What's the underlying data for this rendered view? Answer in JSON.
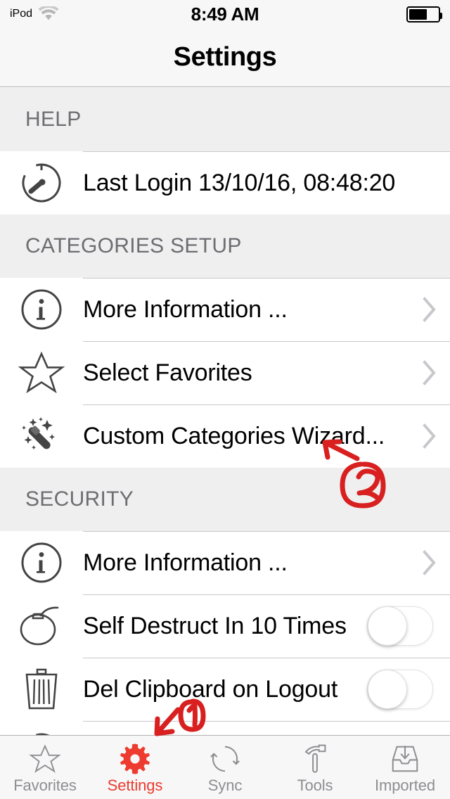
{
  "status_bar": {
    "carrier": "iPod",
    "wifi_icon": "wifi-icon",
    "time": "8:49 AM",
    "battery_icon": "battery-icon",
    "battery_level_percent": 57
  },
  "nav": {
    "title": "Settings"
  },
  "colors": {
    "accent": "#ee3b2f",
    "annotation": "#dd2222",
    "section_header_bg": "#efefef",
    "section_header_text": "#6d6d72",
    "row_bg": "#ffffff",
    "separator": "#c8c7cc",
    "chevron": "#c7c7cc",
    "icon": "#444444",
    "tab_inactive": "#8e8e93"
  },
  "sections": [
    {
      "header": "HELP",
      "rows": [
        {
          "label": "Last Login 13/10/16, 08:48:20",
          "icon": "stopwatch-icon",
          "accessory": "none",
          "name": "row-last-login"
        }
      ]
    },
    {
      "header": "CATEGORIES SETUP",
      "rows": [
        {
          "label": "More Information ...",
          "icon": "info-circle-icon",
          "accessory": "chevron",
          "name": "row-categories-more-information"
        },
        {
          "label": "Select Favorites",
          "icon": "star-outline-icon",
          "accessory": "chevron",
          "name": "row-select-favorites"
        },
        {
          "label": "Custom Categories Wizard...",
          "icon": "magic-wand-icon",
          "accessory": "chevron",
          "name": "row-custom-categories-wizard"
        }
      ]
    },
    {
      "header": "SECURITY",
      "rows": [
        {
          "label": "More Information ...",
          "icon": "info-circle-icon",
          "accessory": "chevron",
          "name": "row-security-more-information"
        },
        {
          "label": "Self Destruct In 10 Times",
          "icon": "bomb-icon",
          "accessory": "toggle",
          "toggle_state": "off",
          "name": "row-self-destruct"
        },
        {
          "label": "Del Clipboard on Logout",
          "icon": "trash-icon",
          "accessory": "toggle",
          "toggle_state": "off",
          "name": "row-del-clipboard-on-logout"
        }
      ]
    }
  ],
  "tab_bar": {
    "items": [
      {
        "label": "Favorites",
        "icon": "star-outline-icon",
        "active": false
      },
      {
        "label": "Settings",
        "icon": "gear-icon",
        "active": true
      },
      {
        "label": "Sync",
        "icon": "sync-arrows-icon",
        "active": false
      },
      {
        "label": "Tools",
        "icon": "hammer-icon",
        "active": false
      },
      {
        "label": "Imported",
        "icon": "inbox-download-icon",
        "active": false
      }
    ]
  },
  "annotations": [
    {
      "text": "2",
      "shape": "circled-number-with-arrow",
      "points_to": "Custom Categories Wizard..."
    },
    {
      "text": "1",
      "shape": "circled-number-with-arrow",
      "points_to": "Settings tab"
    }
  ]
}
